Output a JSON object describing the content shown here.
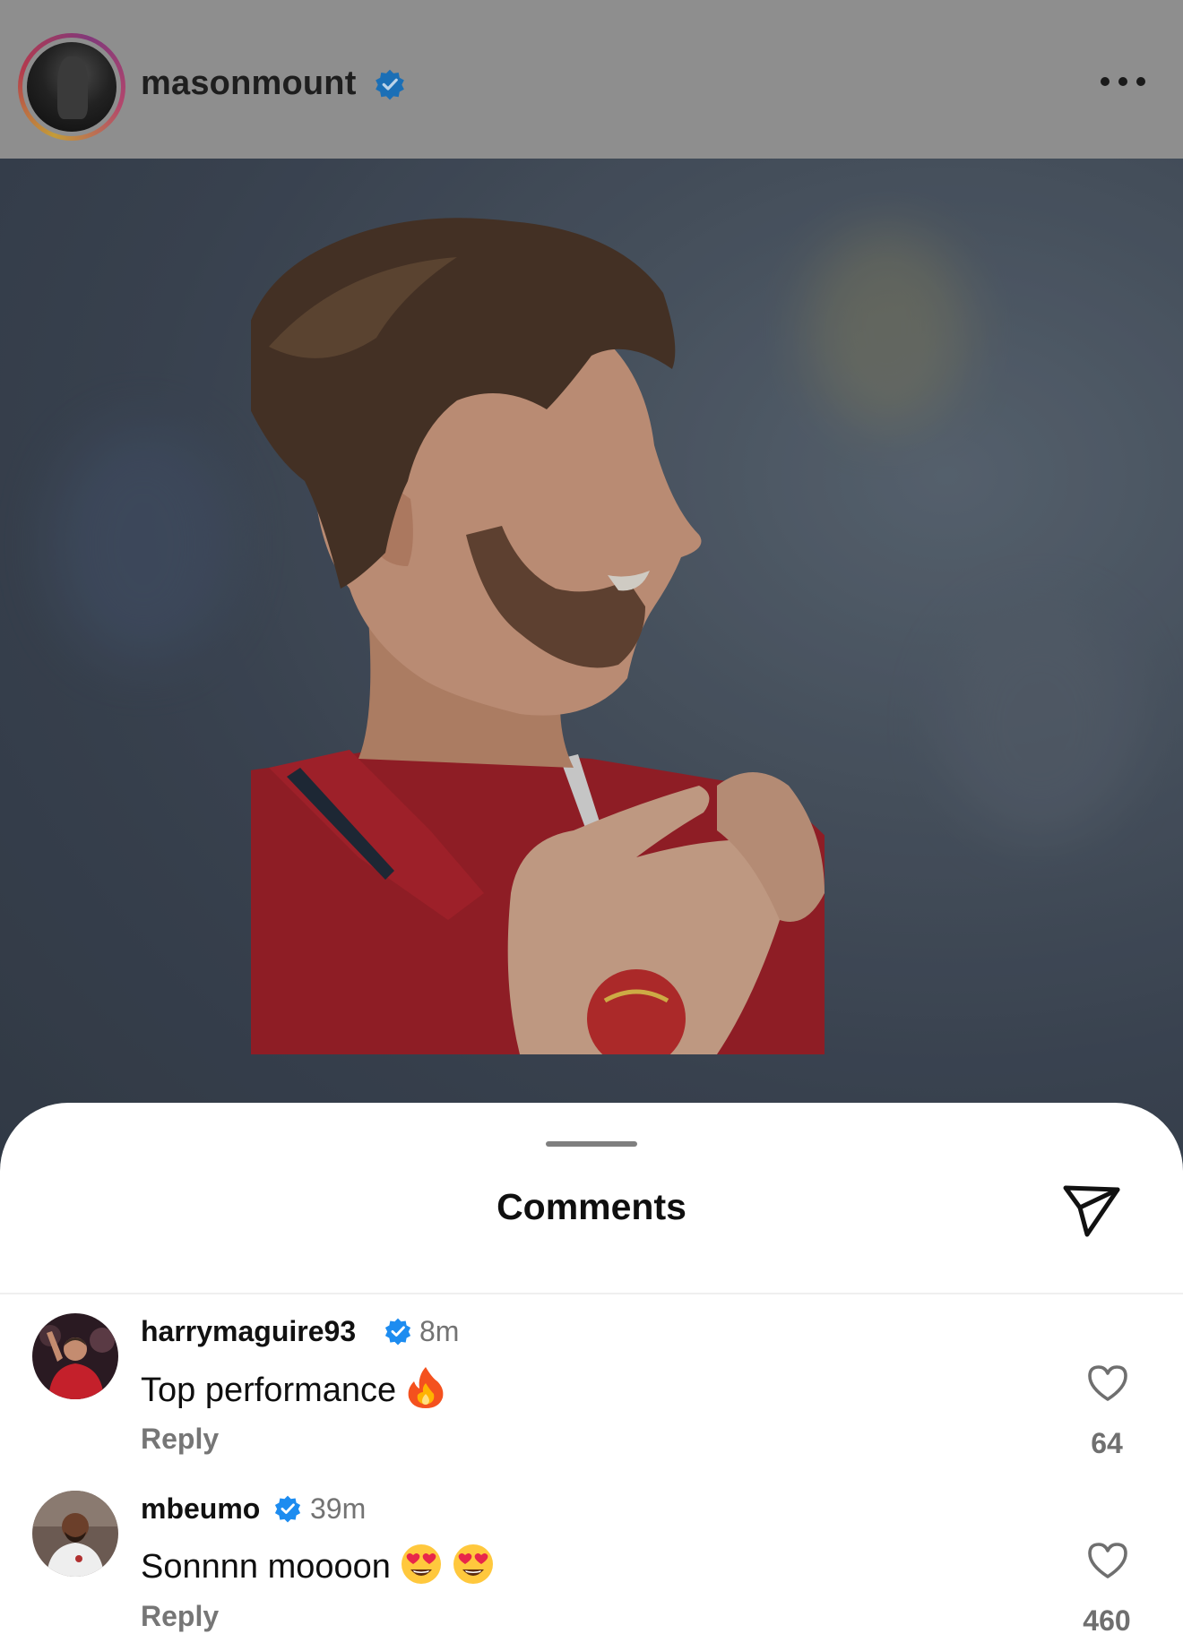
{
  "post": {
    "username": "masonmount",
    "verified": true,
    "more_icon": "more-horizontal-icon"
  },
  "photo": {
    "description_colors": {
      "shirt": "#b41f2a",
      "background": "#3c4757"
    }
  },
  "comments_sheet": {
    "title": "Comments",
    "filter_icon": "send-icon",
    "comments": [
      {
        "username": "harrymaguire93",
        "verified": true,
        "time": "8m",
        "text": "Top performance",
        "emojis": [
          "fire"
        ],
        "reply_label": "Reply",
        "like_count": "64"
      },
      {
        "username": "mbeumo",
        "verified": true,
        "time": "39m",
        "text": "Sonnnn moooon",
        "emojis": [
          "heart-eyes",
          "heart-eyes"
        ],
        "reply_label": "Reply",
        "like_count": "460"
      }
    ]
  },
  "colors": {
    "verified_blue": "#1d8cf0",
    "muted_text": "#737373"
  }
}
